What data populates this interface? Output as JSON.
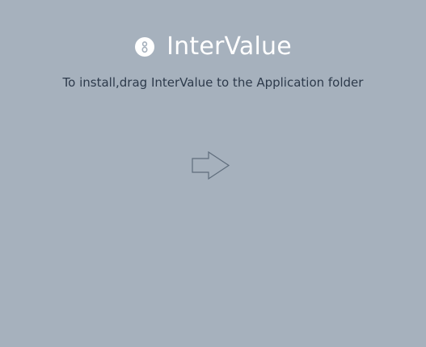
{
  "app": {
    "name": "InterValue",
    "logo_icon": "intervalue-logo-icon"
  },
  "installer": {
    "instruction": "To install,drag InterValue to the Application folder",
    "arrow_icon": "right-arrow-icon"
  },
  "colors": {
    "background": "#a6b1bd",
    "title": "#ffffff",
    "instruction_text": "#2d3a4b",
    "arrow_stroke": "#5f6d7c"
  }
}
